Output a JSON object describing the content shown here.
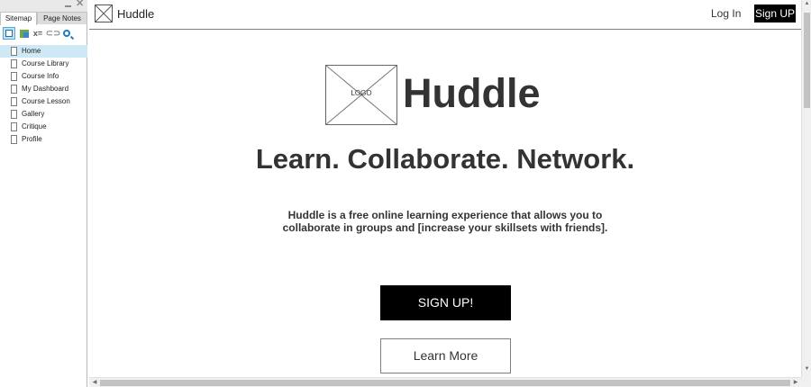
{
  "sidebar": {
    "tabs": [
      {
        "label": "Sitemap"
      },
      {
        "label": "Page Notes"
      }
    ],
    "controls": {
      "minimize_icon": "minimize-icon",
      "close_icon": "close-icon",
      "close_glyph": "✕"
    },
    "toolbar": {
      "pages_icon": "pages-icon",
      "add_icon": "add-page-icon",
      "vars_icon": "variables-icon",
      "vars_glyph": "x=",
      "link_icon": "link-icon",
      "link_glyph": "⊂⊃",
      "search_icon": "search-icon"
    },
    "pages": [
      {
        "label": "Home",
        "selected": true
      },
      {
        "label": "Course Library"
      },
      {
        "label": "Course Info"
      },
      {
        "label": "My Dashboard"
      },
      {
        "label": "Course Lesson"
      },
      {
        "label": "Gallery"
      },
      {
        "label": "Critique"
      },
      {
        "label": "Profile"
      }
    ]
  },
  "header": {
    "brand": "Huddle",
    "login_label": "Log In",
    "signup_label": "Sign UP"
  },
  "hero": {
    "logo_label": "LOGO",
    "brand": "Huddle",
    "tagline": "Learn. Collaborate. Network.",
    "description": "Huddle is a free online learning experience that allows you to collaborate in groups and [increase your skillsets with friends].",
    "signup_label": "SIGN UP!",
    "learn_more_label": "Learn More"
  },
  "scrollbars": {
    "up_glyph": "▲",
    "down_glyph": "▼",
    "left_glyph": "◀",
    "right_glyph": "▶"
  },
  "colors": {
    "selected_row": "#cfe8f6",
    "button_dark": "#000000",
    "text_main": "#333333"
  }
}
